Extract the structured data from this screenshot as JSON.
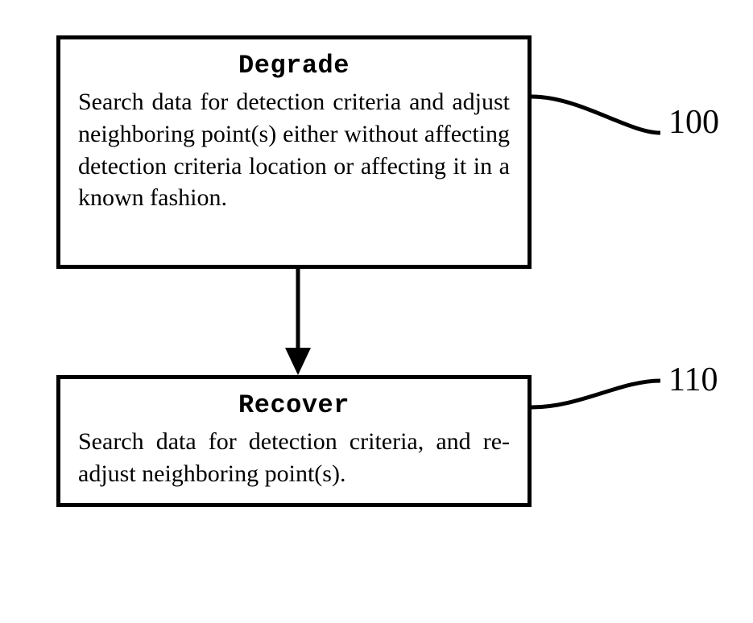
{
  "box100": {
    "ref": "100",
    "title": "Degrade",
    "body": "Search data for detection criteria and adjust neighboring point(s) either without affecting detection criteria location or affecting it in a known fashion."
  },
  "box110": {
    "ref": "110",
    "title": "Recover",
    "body": "Search data for detection criteria, and re-adjust neighboring point(s)."
  }
}
